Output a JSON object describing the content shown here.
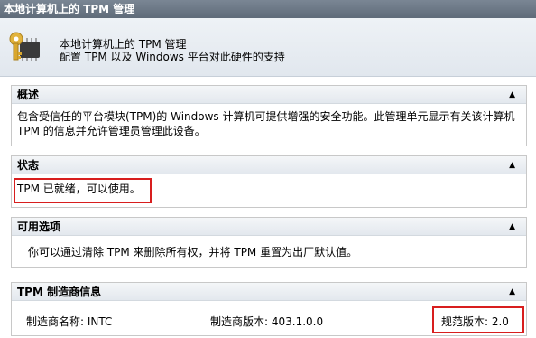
{
  "window": {
    "title": "本地计算机上的 TPM 管理"
  },
  "header": {
    "icon": "key-chip-icon",
    "line1": "本地计算机上的 TPM 管理",
    "line2": "配置 TPM 以及 Windows 平台对此硬件的支持"
  },
  "sections": {
    "overview": {
      "title": "概述",
      "text": "包含受信任的平台模块(TPM)的 Windows 计算机可提供增强的安全功能。此管理单元显示有关该计算机 TPM 的信息并允许管理员管理此设备。"
    },
    "status": {
      "title": "状态",
      "text": "TPM 已就绪，可以使用。"
    },
    "options": {
      "title": "可用选项",
      "text": "你可以通过清除 TPM 来删除所有权，并将 TPM 重置为出厂默认值。"
    },
    "manufacturer": {
      "title": "TPM 制造商信息",
      "name": "制造商名称: INTC",
      "version": "制造商版本: 403.1.0.0",
      "spec": "规范版本: 2.0"
    }
  },
  "colors": {
    "highlight": "#d81e1e",
    "titlebar": "#6b7785"
  },
  "collapse_glyph": "▲"
}
